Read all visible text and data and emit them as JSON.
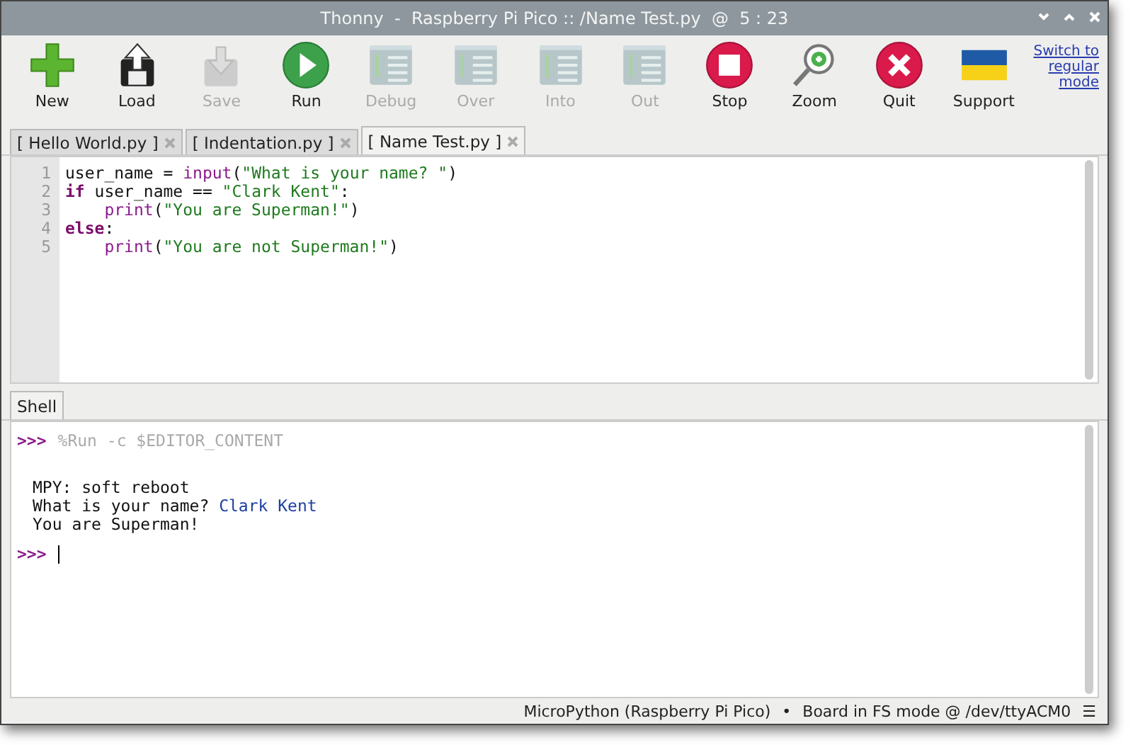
{
  "window": {
    "title": "Thonny  -  Raspberry Pi Pico :: /Name Test.py  @  5 : 23"
  },
  "toolbar": [
    {
      "label": "New",
      "kind": "new",
      "disabled": false
    },
    {
      "label": "Load",
      "kind": "load",
      "disabled": false
    },
    {
      "label": "Save",
      "kind": "save",
      "disabled": true
    },
    {
      "label": "Run",
      "kind": "run",
      "disabled": false
    },
    {
      "label": "Debug",
      "kind": "debug",
      "disabled": true
    },
    {
      "label": "Over",
      "kind": "over",
      "disabled": true
    },
    {
      "label": "Into",
      "kind": "into",
      "disabled": true
    },
    {
      "label": "Out",
      "kind": "out",
      "disabled": true
    },
    {
      "label": "Stop",
      "kind": "stop",
      "disabled": false
    },
    {
      "label": "Zoom",
      "kind": "zoom",
      "disabled": false
    },
    {
      "label": "Quit",
      "kind": "quit",
      "disabled": false
    },
    {
      "label": "Support",
      "kind": "flag",
      "disabled": false
    }
  ],
  "mode_link": "Switch to regular mode",
  "tabs": [
    {
      "label": "[ Hello World.py ]",
      "selected": false
    },
    {
      "label": "[ Indentation.py ]",
      "selected": false
    },
    {
      "label": "[ Name Test.py ]",
      "selected": true
    }
  ],
  "editor": {
    "lines": [
      {
        "number": "1",
        "indented": false,
        "tokens": [
          {
            "kind": "plain",
            "text": "user_name = "
          },
          {
            "kind": "builtin",
            "text": "input"
          },
          {
            "kind": "plain",
            "text": "("
          },
          {
            "kind": "string",
            "text": "\"What is your name? \""
          },
          {
            "kind": "plain",
            "text": ")"
          }
        ]
      },
      {
        "number": "2",
        "indented": false,
        "tokens": [
          {
            "kind": "keyword",
            "text": "if"
          },
          {
            "kind": "plain",
            "text": " user_name == "
          },
          {
            "kind": "string",
            "text": "\"Clark Kent\""
          },
          {
            "kind": "plain",
            "text": ":"
          }
        ]
      },
      {
        "number": "3",
        "indented": true,
        "tokens": [
          {
            "kind": "builtin",
            "text": "print"
          },
          {
            "kind": "plain",
            "text": "("
          },
          {
            "kind": "string",
            "text": "\"You are Superman!\""
          },
          {
            "kind": "plain",
            "text": ")"
          }
        ]
      },
      {
        "number": "4",
        "indented": false,
        "tokens": [
          {
            "kind": "keyword",
            "text": "else"
          },
          {
            "kind": "plain",
            "text": ":"
          }
        ]
      },
      {
        "number": "5",
        "indented": true,
        "tokens": [
          {
            "kind": "builtin",
            "text": "print"
          },
          {
            "kind": "plain",
            "text": "("
          },
          {
            "kind": "string",
            "text": "\"You are not Superman!\""
          },
          {
            "kind": "plain",
            "text": ")"
          }
        ]
      }
    ]
  },
  "shell": {
    "tab": "Shell",
    "lines": [
      {
        "kind": "command",
        "tokens": [
          {
            "kind": "prompt",
            "text": ">>>"
          },
          {
            "kind": "magic",
            "text": "%Run -c $EDITOR_CONTENT"
          }
        ]
      },
      {
        "kind": "output",
        "tokens": [
          {
            "kind": "output",
            "text": "MPY: soft reboot"
          }
        ]
      },
      {
        "kind": "output",
        "tokens": [
          {
            "kind": "output",
            "text": "What is your name? "
          },
          {
            "kind": "input",
            "text": "Clark Kent"
          }
        ]
      },
      {
        "kind": "output",
        "tokens": [
          {
            "kind": "output",
            "text": "You are Superman!"
          }
        ]
      },
      {
        "kind": "prompt",
        "tokens": [
          {
            "kind": "prompt",
            "text": ">>>"
          }
        ]
      }
    ]
  },
  "status_bar": {
    "interpreter": "MicroPython (Raspberry Pi Pico)",
    "separator": "•",
    "port": "Board in FS mode @ /dev/ttyACM0",
    "menu": "☰"
  }
}
